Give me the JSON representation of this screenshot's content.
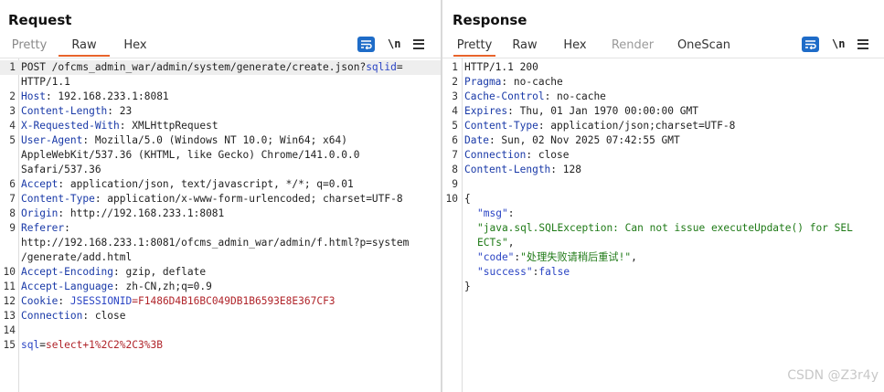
{
  "request": {
    "title": "Request",
    "tabs": [
      {
        "label": "Pretty"
      },
      {
        "label": "Raw"
      },
      {
        "label": "Hex"
      }
    ],
    "active_tab": "Raw",
    "newline_label": "\\n",
    "lines": [
      {
        "n": "1",
        "parts": [
          {
            "t": "POST /ofcms_admin_war/admin/system/generate/create.json?"
          },
          {
            "t": "sqlid",
            "c": "blue"
          },
          {
            "t": "="
          }
        ]
      },
      {
        "n": "",
        "parts": [
          {
            "t": "HTTP/1.1"
          }
        ]
      },
      {
        "n": "2",
        "parts": [
          {
            "t": "Host",
            "c": "hdr"
          },
          {
            "t": ": 192.168.233.1:8081"
          }
        ]
      },
      {
        "n": "3",
        "parts": [
          {
            "t": "Content-Length",
            "c": "hdr"
          },
          {
            "t": ": 23"
          }
        ]
      },
      {
        "n": "4",
        "parts": [
          {
            "t": "X-Requested-With",
            "c": "hdr"
          },
          {
            "t": ": XMLHttpRequest"
          }
        ]
      },
      {
        "n": "5",
        "parts": [
          {
            "t": "User-Agent",
            "c": "hdr"
          },
          {
            "t": ": Mozilla/5.0 (Windows NT 10.0; Win64; x64)"
          }
        ]
      },
      {
        "n": "",
        "parts": [
          {
            "t": "AppleWebKit/537.36 (KHTML, like Gecko) Chrome/141.0.0.0"
          }
        ]
      },
      {
        "n": "",
        "parts": [
          {
            "t": "Safari/537.36"
          }
        ]
      },
      {
        "n": "6",
        "parts": [
          {
            "t": "Accept",
            "c": "hdr"
          },
          {
            "t": ": application/json, text/javascript, */*; q=0.01"
          }
        ]
      },
      {
        "n": "7",
        "parts": [
          {
            "t": "Content-Type",
            "c": "hdr"
          },
          {
            "t": ": application/x-www-form-urlencoded; charset=UTF-8"
          }
        ]
      },
      {
        "n": "8",
        "parts": [
          {
            "t": "Origin",
            "c": "hdr"
          },
          {
            "t": ": http://192.168.233.1:8081"
          }
        ]
      },
      {
        "n": "9",
        "parts": [
          {
            "t": "Referer",
            "c": "hdr"
          },
          {
            "t": ":"
          }
        ]
      },
      {
        "n": "",
        "parts": [
          {
            "t": "http://192.168.233.1:8081/ofcms_admin_war/admin/f.html?p=system"
          }
        ]
      },
      {
        "n": "",
        "parts": [
          {
            "t": "/generate/add.html"
          }
        ]
      },
      {
        "n": "10",
        "parts": [
          {
            "t": "Accept-Encoding",
            "c": "hdr"
          },
          {
            "t": ": gzip, deflate"
          }
        ]
      },
      {
        "n": "11",
        "parts": [
          {
            "t": "Accept-Language",
            "c": "hdr"
          },
          {
            "t": ": zh-CN,zh;q=0.9"
          }
        ]
      },
      {
        "n": "12",
        "parts": [
          {
            "t": "Cookie",
            "c": "hdr"
          },
          {
            "t": ": "
          },
          {
            "t": "JSESSIONID",
            "c": "blue"
          },
          {
            "t": "=F1486D4B16BC049DB1B6593E8E367CF3",
            "c": "red"
          }
        ]
      },
      {
        "n": "13",
        "parts": [
          {
            "t": "Connection",
            "c": "hdr"
          },
          {
            "t": ": close"
          }
        ]
      },
      {
        "n": "14",
        "parts": []
      },
      {
        "n": "15",
        "parts": [
          {
            "t": "sql",
            "c": "blue"
          },
          {
            "t": "="
          },
          {
            "t": "select+1%2C2%2C3%3B",
            "c": "red"
          }
        ]
      }
    ]
  },
  "response": {
    "title": "Response",
    "tabs": [
      {
        "label": "Pretty"
      },
      {
        "label": "Raw"
      },
      {
        "label": "Hex"
      },
      {
        "label": "Render"
      },
      {
        "label": "OneScan"
      }
    ],
    "active_tab": "Pretty",
    "newline_label": "\\n",
    "lines": [
      {
        "n": "1",
        "parts": [
          {
            "t": "HTTP/1.1 200"
          }
        ]
      },
      {
        "n": "2",
        "parts": [
          {
            "t": "Pragma",
            "c": "hdr"
          },
          {
            "t": ": no-cache"
          }
        ]
      },
      {
        "n": "3",
        "parts": [
          {
            "t": "Cache-Control",
            "c": "hdr"
          },
          {
            "t": ": no-cache"
          }
        ]
      },
      {
        "n": "4",
        "parts": [
          {
            "t": "Expires",
            "c": "hdr"
          },
          {
            "t": ": Thu, 01 Jan 1970 00:00:00 GMT"
          }
        ]
      },
      {
        "n": "5",
        "parts": [
          {
            "t": "Content-Type",
            "c": "hdr"
          },
          {
            "t": ": application/json;charset=UTF-8"
          }
        ]
      },
      {
        "n": "6",
        "parts": [
          {
            "t": "Date",
            "c": "hdr"
          },
          {
            "t": ": Sun, 02 Nov 2025 07:42:55 GMT"
          }
        ]
      },
      {
        "n": "7",
        "parts": [
          {
            "t": "Connection",
            "c": "hdr"
          },
          {
            "t": ": close"
          }
        ]
      },
      {
        "n": "8",
        "parts": [
          {
            "t": "Content-Length",
            "c": "hdr"
          },
          {
            "t": ": 128"
          }
        ]
      },
      {
        "n": "9",
        "parts": []
      },
      {
        "n": "10",
        "parts": [
          {
            "t": "{"
          }
        ]
      },
      {
        "n": "",
        "indent": 1,
        "parts": [
          {
            "t": "\"msg\"",
            "c": "jkey"
          },
          {
            "t": ":"
          }
        ]
      },
      {
        "n": "",
        "indent": 1,
        "parts": [
          {
            "t": "\"java.sql.SQLException: Can not issue executeUpdate() for SEL",
            "c": "jstr"
          }
        ]
      },
      {
        "n": "",
        "indent": 1,
        "parts": [
          {
            "t": "ECTs\"",
            "c": "jstr"
          },
          {
            "t": ","
          }
        ]
      },
      {
        "n": "",
        "indent": 1,
        "parts": [
          {
            "t": "\"code\"",
            "c": "jkey"
          },
          {
            "t": ":"
          },
          {
            "t": "\"处理失败请稍后重试!\"",
            "c": "jstr"
          },
          {
            "t": ","
          }
        ]
      },
      {
        "n": "",
        "indent": 1,
        "parts": [
          {
            "t": "\"success\"",
            "c": "jkey"
          },
          {
            "t": ":"
          },
          {
            "t": "false",
            "c": "jval"
          }
        ]
      },
      {
        "n": "",
        "parts": [
          {
            "t": "}"
          }
        ]
      }
    ]
  },
  "watermark": "CSDN @Z3r4y",
  "colors": {
    "accent_tab_underline": "#e8642c",
    "button_blue": "#1e6cc8",
    "header_name": "#1a3aa8",
    "value_red": "#b0242a",
    "json_string": "#1f7a17"
  },
  "icons": {
    "wrap": "word-wrap-icon",
    "newline": "newline-toggle-icon",
    "menu": "hamburger-menu-icon",
    "layout_side": "split-side-by-side-icon",
    "layout_top": "split-top-bottom-icon",
    "layout_tabs": "single-pane-icon"
  }
}
